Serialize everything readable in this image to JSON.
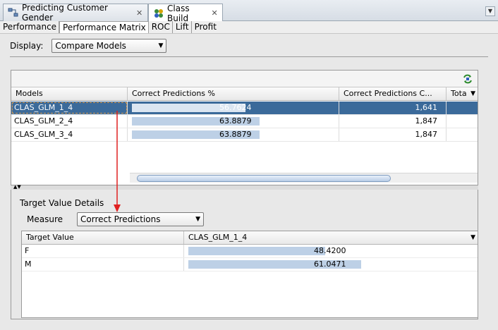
{
  "editor_tabs": [
    {
      "label": "Predicting Customer Gender",
      "icon": "workflow-icon",
      "active": false
    },
    {
      "label": "Class Build",
      "icon": "class-build-icon",
      "active": true
    }
  ],
  "close_glyph": "✕",
  "sub_tabs": [
    "Performance",
    "Performance Matrix",
    "ROC",
    "Lift",
    "Profit"
  ],
  "active_sub_tab": "Performance Matrix",
  "display": {
    "label": "Display:",
    "value": "Compare Models"
  },
  "models_table": {
    "columns": [
      "Models",
      "Correct Predictions %",
      "Correct Predictions C...",
      "Tota"
    ],
    "rows": [
      {
        "model": "CLAS_GLM_1_4",
        "pct": "56.7624",
        "pct_value": 56.7624,
        "count": "1,641",
        "selected": true
      },
      {
        "model": "CLAS_GLM_2_4",
        "pct": "63.8879",
        "pct_value": 63.8879,
        "count": "1,847",
        "selected": false
      },
      {
        "model": "CLAS_GLM_3_4",
        "pct": "63.8879",
        "pct_value": 63.8879,
        "count": "1,847",
        "selected": false
      }
    ]
  },
  "details": {
    "title": "Target Value Details",
    "measure_label": "Measure",
    "measure_value": "Correct Predictions",
    "columns": [
      "Target Value",
      "CLAS_GLM_1_4"
    ],
    "rows": [
      {
        "target": "F",
        "value": "48.4200",
        "value_num": 48.42
      },
      {
        "target": "M",
        "value": "61.0471",
        "value_num": 61.0471
      }
    ]
  },
  "colors": {
    "selection": "#3b6a9a",
    "bar": "#bdd0e6",
    "annotation_arrow": "#e02020"
  }
}
